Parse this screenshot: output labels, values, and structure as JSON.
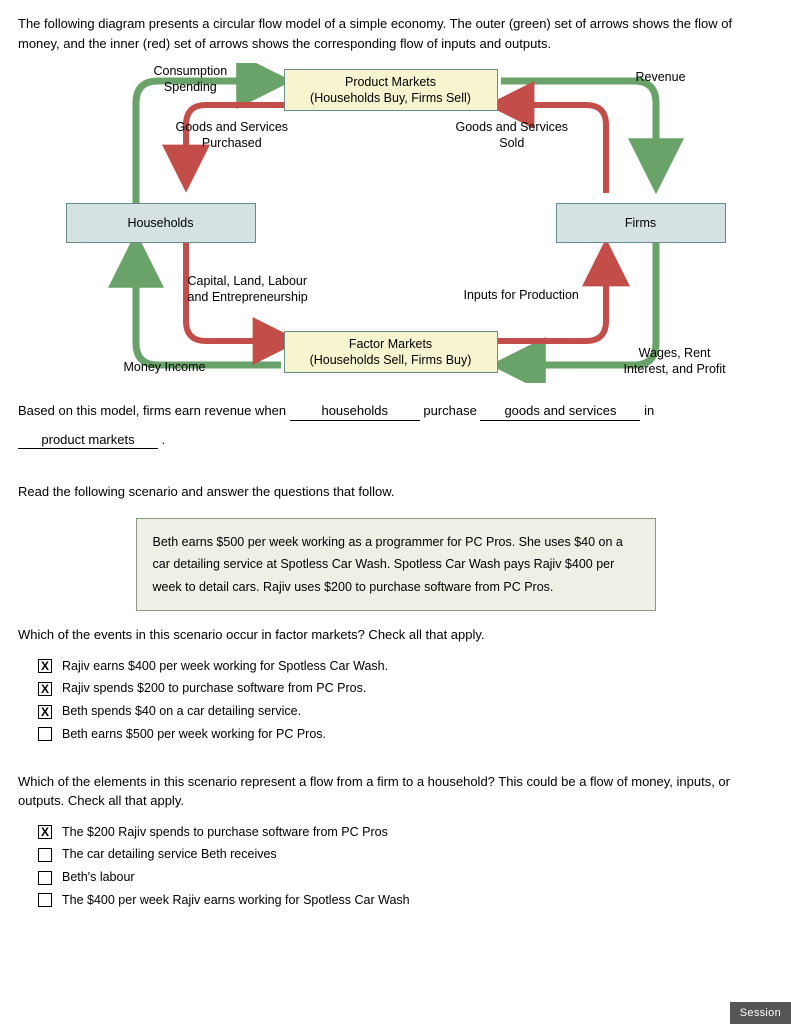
{
  "intro": "The following diagram presents a circular flow model of a simple economy. The outer (green) set of arrows shows the flow of money, and the inner (red) set of arrows shows the corresponding flow of inputs and outputs.",
  "diagram": {
    "nodes": {
      "product_markets": {
        "line1": "Product Markets",
        "line2": "(Households Buy, Firms Sell)"
      },
      "factor_markets": {
        "line1": "Factor Markets",
        "line2": "(Households Sell, Firms Buy)"
      },
      "households": "Households",
      "firms": "Firms"
    },
    "labels": {
      "consumption_spending": {
        "line1": "Consumption",
        "line2": "Spending"
      },
      "revenue": "Revenue",
      "goods_purchased": {
        "line1": "Goods and Services",
        "line2": "Purchased"
      },
      "goods_sold": {
        "line1": "Goods and Services",
        "line2": "Sold"
      },
      "capital_etc": {
        "line1": "Capital, Land, Labour",
        "line2": "and Entrepreneurship"
      },
      "inputs_for_production": "Inputs for Production",
      "money_income": "Money Income",
      "wages_etc": {
        "line1": "Wages, Rent",
        "line2": "Interest, and Profit"
      }
    },
    "colors": {
      "money": "#6aa36a",
      "real": "#c24d49"
    }
  },
  "fill": {
    "lead": "Based on this model, firms earn revenue when",
    "blank1": "households",
    "mid1": "purchase",
    "blank2": "goods and services",
    "mid2": "in",
    "blank3": "product markets",
    "tail": "."
  },
  "scenario_lead": "Read the following scenario and answer the questions that follow.",
  "scenario_box": "Beth earns $500 per week working as a programmer for PC Pros. She uses $40 on a car detailing service at Spotless Car Wash. Spotless Car Wash pays Rajiv $400 per week to detail cars. Rajiv uses $200 to purchase software from PC Pros.",
  "q1": {
    "prompt": "Which of the events in this scenario occur in factor markets? Check all that apply.",
    "options": [
      {
        "label": "Rajiv earns $400 per week working for Spotless Car Wash.",
        "checked": true
      },
      {
        "label": "Rajiv spends $200 to purchase software from PC Pros.",
        "checked": true
      },
      {
        "label": "Beth spends $40 on a car detailing service.",
        "checked": true
      },
      {
        "label": "Beth earns $500 per week working for PC Pros.",
        "checked": false
      }
    ]
  },
  "q2": {
    "prompt": "Which of the elements in this scenario represent a flow from a firm to a household? This could be a flow of money, inputs, or outputs. Check all that apply.",
    "options": [
      {
        "label": "The $200 Rajiv spends to purchase software from PC Pros",
        "checked": true
      },
      {
        "label": "The car detailing service Beth receives",
        "checked": false
      },
      {
        "label": "Beth's labour",
        "checked": false
      },
      {
        "label": "The $400 per week Rajiv earns working for Spotless Car Wash",
        "checked": false
      }
    ]
  },
  "session_tab": "Session"
}
